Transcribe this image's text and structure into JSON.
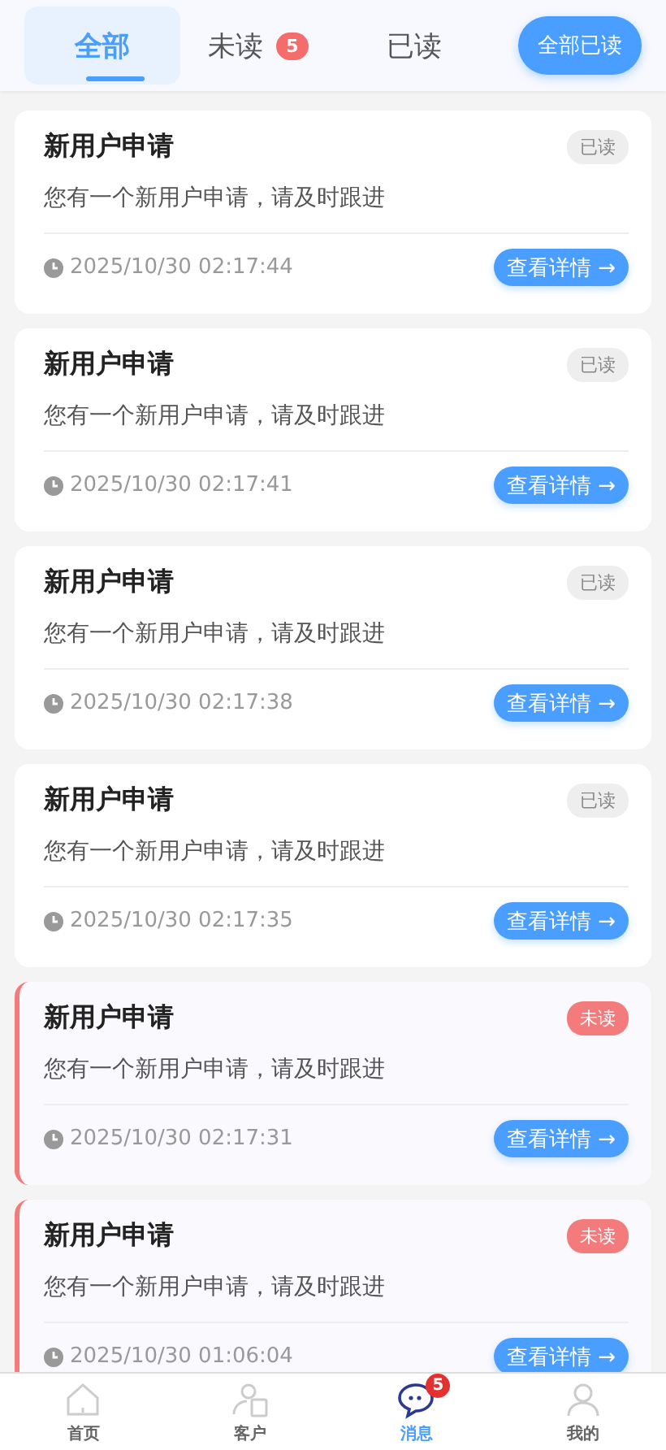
{
  "tabs": [
    {
      "label": "全部",
      "selected": true
    },
    {
      "label": "未读",
      "selected": false,
      "badge": "5"
    },
    {
      "label": "已读",
      "selected": false
    }
  ],
  "mark_all_button": "全部已读",
  "messages": [
    {
      "title": "新用户申请",
      "status": "已读",
      "read": true,
      "body": "您有一个新用户申请，请及时跟进",
      "time": "2025/10/30 02:17:44",
      "action": "查看详情 →"
    },
    {
      "title": "新用户申请",
      "status": "已读",
      "read": true,
      "body": "您有一个新用户申请，请及时跟进",
      "time": "2025/10/30 02:17:41",
      "action": "查看详情 →"
    },
    {
      "title": "新用户申请",
      "status": "已读",
      "read": true,
      "body": "您有一个新用户申请，请及时跟进",
      "time": "2025/10/30 02:17:38",
      "action": "查看详情 →"
    },
    {
      "title": "新用户申请",
      "status": "已读",
      "read": true,
      "body": "您有一个新用户申请，请及时跟进",
      "time": "2025/10/30 02:17:35",
      "action": "查看详情 →"
    },
    {
      "title": "新用户申请",
      "status": "未读",
      "read": false,
      "body": "您有一个新用户申请，请及时跟进",
      "time": "2025/10/30 02:17:31",
      "action": "查看详情 →"
    },
    {
      "title": "新用户申请",
      "status": "未读",
      "read": false,
      "body": "您有一个新用户申请，请及时跟进",
      "time": "2025/10/30 01:06:04",
      "action": "查看详情 →"
    }
  ],
  "bottom_nav": [
    {
      "kind": "home",
      "label": "首页",
      "selected": false
    },
    {
      "kind": "customer",
      "label": "客户",
      "selected": false
    },
    {
      "kind": "message",
      "label": "消息",
      "selected": true,
      "badge": "5"
    },
    {
      "kind": "profile",
      "label": "我的",
      "selected": false
    }
  ]
}
